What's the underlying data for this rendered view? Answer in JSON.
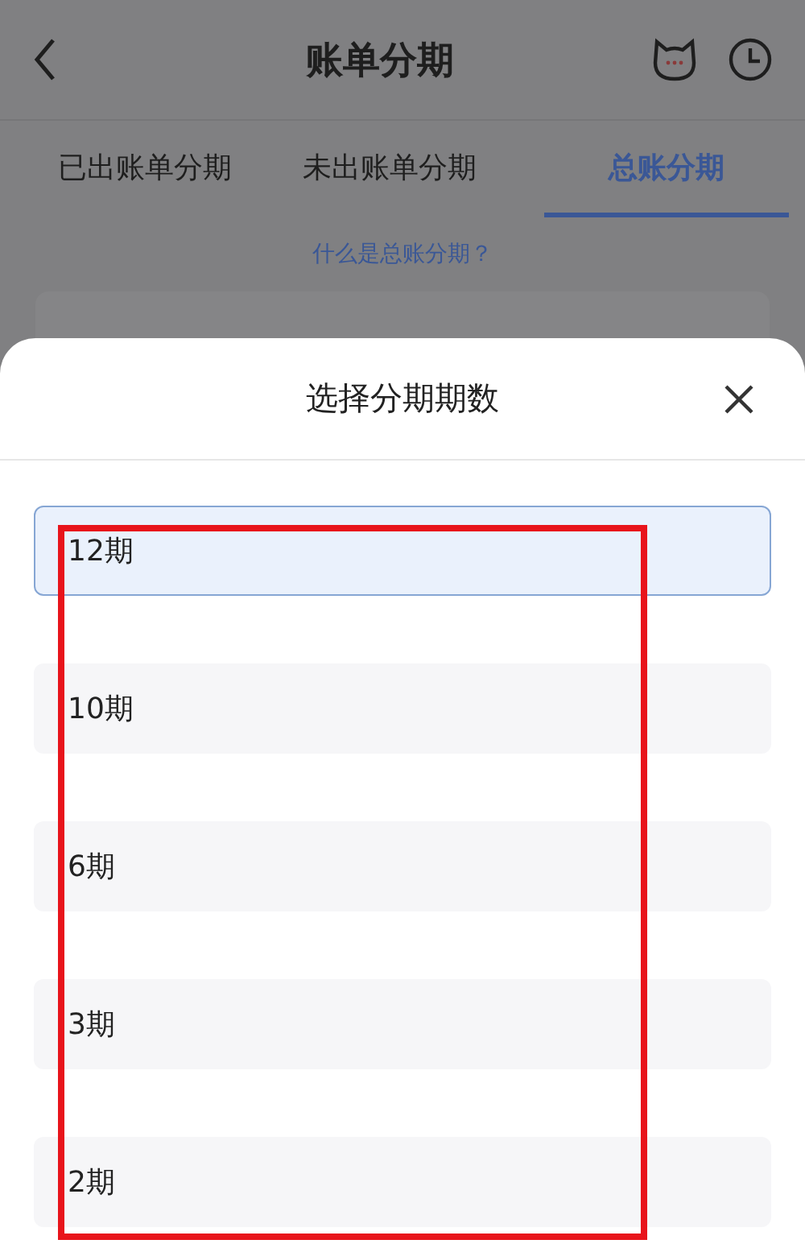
{
  "header": {
    "title": "账单分期"
  },
  "tabs": [
    {
      "label": "已出账单分期",
      "selected": false
    },
    {
      "label": "未出账单分期",
      "selected": false
    },
    {
      "label": "总账分期",
      "selected": true
    }
  ],
  "link": "什么是总账分期？",
  "sheet": {
    "title": "选择分期期数",
    "options": [
      {
        "label": "12期",
        "selected": true
      },
      {
        "label": "10期",
        "selected": false
      },
      {
        "label": "6期",
        "selected": false
      },
      {
        "label": "3期",
        "selected": false
      },
      {
        "label": "2期",
        "selected": false
      }
    ]
  }
}
